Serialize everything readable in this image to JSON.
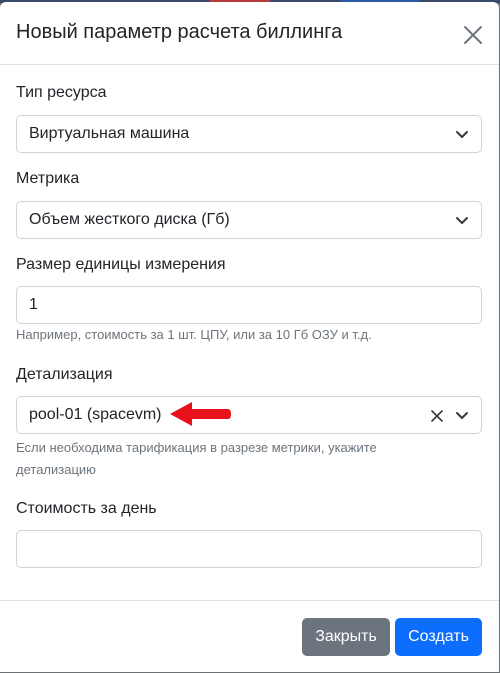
{
  "modal": {
    "title": "Новый параметр расчета биллинга"
  },
  "fields": {
    "resource_type": {
      "label": "Тип ресурса",
      "value": "Виртуальная машина"
    },
    "metric": {
      "label": "Метрика",
      "value": "Объем жесткого диска (Гб)"
    },
    "unit_size": {
      "label": "Размер единицы измерения",
      "value": "1",
      "help": "Например, стоимость за 1 шт. ЦПУ, или за 10 Гб ОЗУ и т.д."
    },
    "detail": {
      "label": "Детализация",
      "value": "pool-01 (spacevm)",
      "help_line1": "Если необходима тарификация в разрезе метрики, укажите",
      "help_line2": "детализацию"
    },
    "daily_cost": {
      "label": "Стоимость за день",
      "value": ""
    }
  },
  "footer": {
    "close_label": "Закрыть",
    "create_label": "Создать"
  },
  "colors": {
    "primary": "#0d6efd",
    "secondary": "#6c757d",
    "annotation_arrow": "#e8121b"
  },
  "icons": {
    "close": "close-icon",
    "dropdown": "chevron-down-icon",
    "clear": "clear-icon",
    "annotation": "red-arrow-annotation"
  }
}
